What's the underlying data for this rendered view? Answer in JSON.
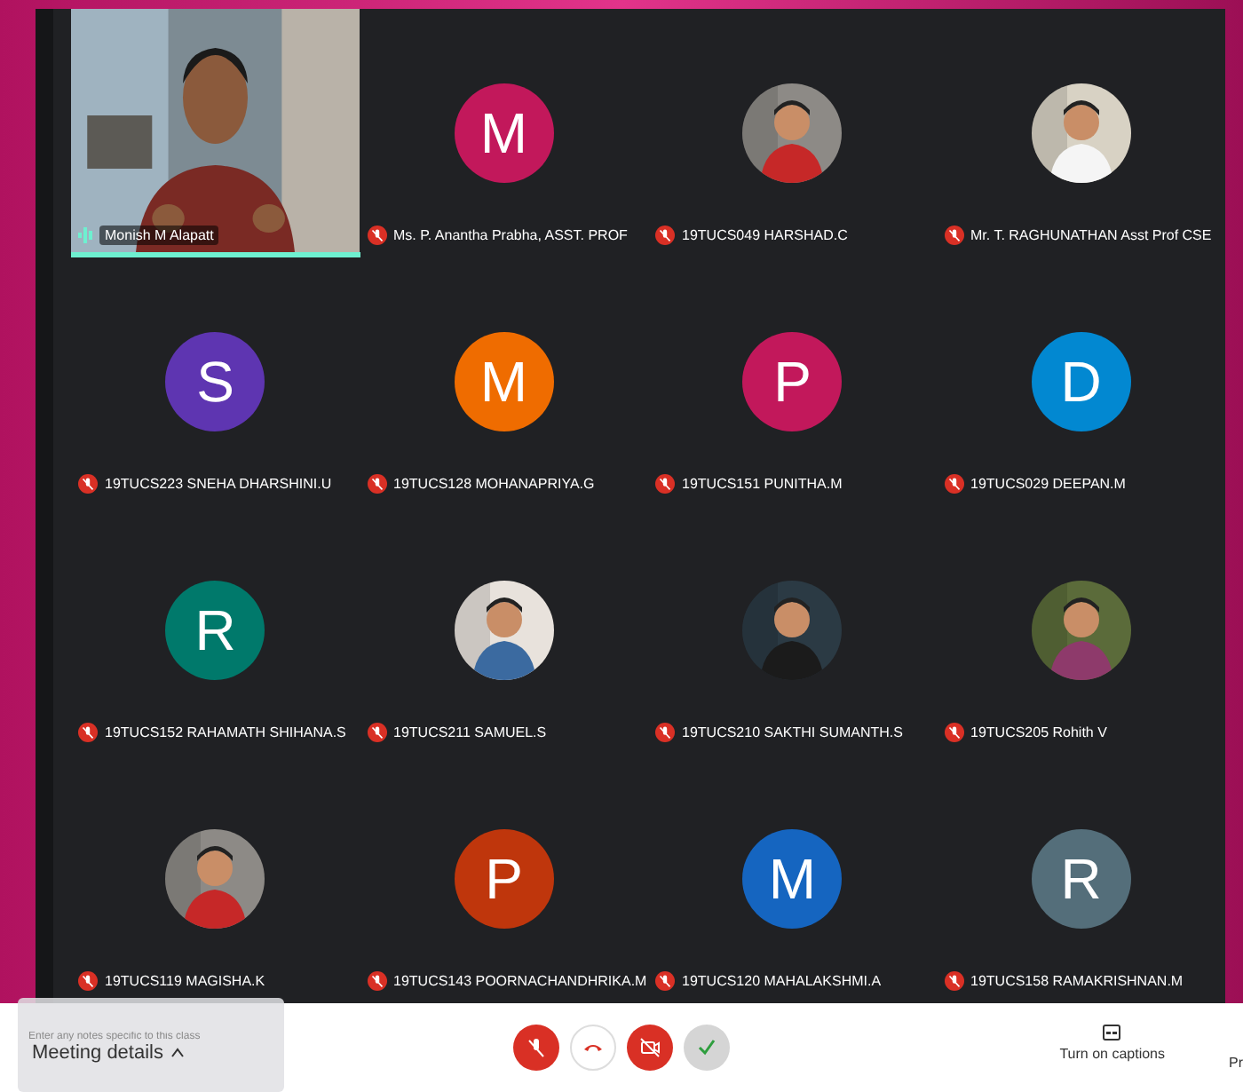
{
  "participants": [
    {
      "kind": "video",
      "name": "Monish M Alapatt",
      "speaking": true
    },
    {
      "kind": "letter",
      "name": "Ms. P. Anantha Prabha, ASST. PROF",
      "letter": "M",
      "color": "#c2185b",
      "muted": true
    },
    {
      "kind": "picture",
      "name": "19TUCS049 HARSHAD.C",
      "muted": true
    },
    {
      "kind": "picture",
      "name": "Mr. T. RAGHUNATHAN Asst Prof CSE",
      "muted": true
    },
    {
      "kind": "letter",
      "name": "19TUCS223 SNEHA DHARSHINI.U",
      "letter": "S",
      "color": "#5e35b1",
      "muted": true
    },
    {
      "kind": "letter",
      "name": "19TUCS128 MOHANAPRIYA.G",
      "letter": "M",
      "color": "#ef6c00",
      "muted": true
    },
    {
      "kind": "letter",
      "name": "19TUCS151 PUNITHA.M",
      "letter": "P",
      "color": "#c2185b",
      "muted": true
    },
    {
      "kind": "letter",
      "name": "19TUCS029 DEEPAN.M",
      "letter": "D",
      "color": "#0288d1",
      "muted": true
    },
    {
      "kind": "letter",
      "name": "19TUCS152 RAHAMATH SHIHANA.S",
      "letter": "R",
      "color": "#00796b",
      "muted": true
    },
    {
      "kind": "picture",
      "name": "19TUCS211 SAMUEL.S",
      "muted": true
    },
    {
      "kind": "picture",
      "name": "19TUCS210 SAKTHI SUMANTH.S",
      "muted": true
    },
    {
      "kind": "picture",
      "name": "19TUCS205 Rohith V",
      "muted": true
    },
    {
      "kind": "picture",
      "name": "19TUCS119 MAGISHA.K",
      "muted": true
    },
    {
      "kind": "letter",
      "name": "19TUCS143 POORNACHANDHRIKA.M",
      "letter": "P",
      "color": "#bf360c",
      "muted": true
    },
    {
      "kind": "letter",
      "name": "19TUCS120 MAHALAKSHMI.A",
      "letter": "M",
      "color": "#1565c0",
      "muted": true
    },
    {
      "kind": "letter",
      "name": "19TUCS158 RAMAKRISHNAN.M",
      "letter": "R",
      "color": "#546e7a",
      "muted": true
    }
  ],
  "notes_popup": {
    "placeholder": "Enter any notes specific to this class"
  },
  "meeting_details": "Meeting details",
  "controls": {
    "mic_muted": true,
    "camera_off": true
  },
  "captions": "Turn on captions",
  "cut_label": "Pr"
}
